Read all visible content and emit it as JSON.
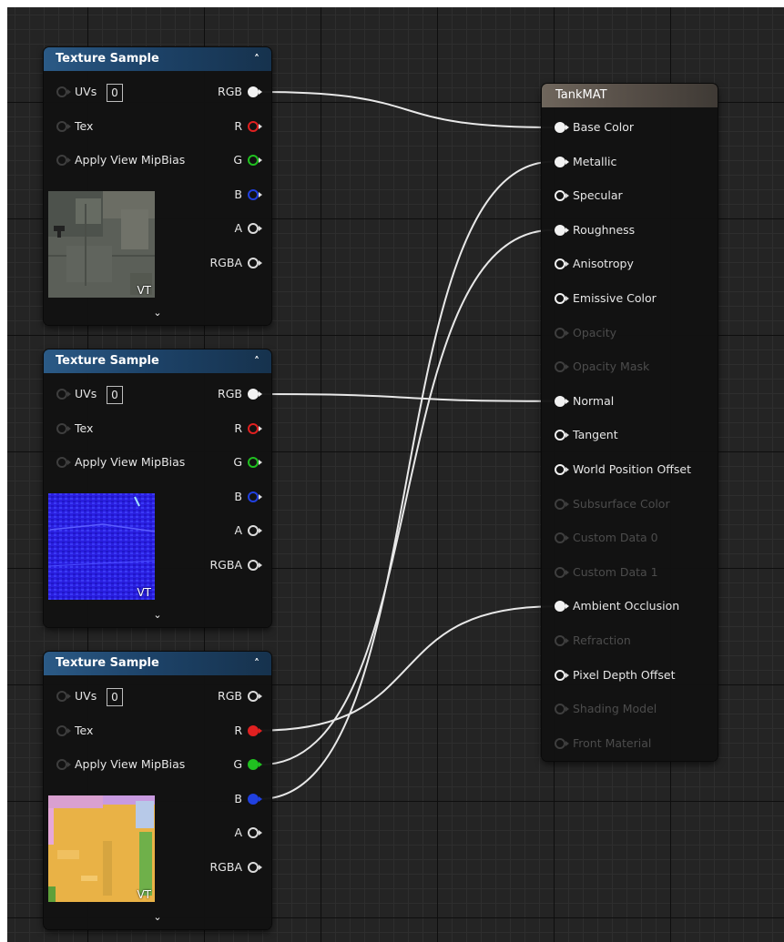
{
  "texture_nodes": [
    {
      "title": "Texture Sample",
      "uv_label": "UVs",
      "uv_value": "0",
      "tex_label": "Tex",
      "mip_label": "Apply View MipBias",
      "vt_label": "VT",
      "outputs": [
        {
          "label": "RGB",
          "color": "#f2f2f2",
          "connected": true
        },
        {
          "label": "R",
          "color": "#e02020",
          "connected": false
        },
        {
          "label": "G",
          "color": "#20c020",
          "connected": false
        },
        {
          "label": "B",
          "color": "#2040e0",
          "connected": false
        },
        {
          "label": "A",
          "color": "#dcdcdc",
          "connected": false
        },
        {
          "label": "RGBA",
          "color": "#dcdcdc",
          "connected": false
        }
      ]
    },
    {
      "title": "Texture Sample",
      "uv_label": "UVs",
      "uv_value": "0",
      "tex_label": "Tex",
      "mip_label": "Apply View MipBias",
      "vt_label": "VT",
      "outputs": [
        {
          "label": "RGB",
          "color": "#f2f2f2",
          "connected": true
        },
        {
          "label": "R",
          "color": "#e02020",
          "connected": false
        },
        {
          "label": "G",
          "color": "#20c020",
          "connected": false
        },
        {
          "label": "B",
          "color": "#2040e0",
          "connected": false
        },
        {
          "label": "A",
          "color": "#dcdcdc",
          "connected": false
        },
        {
          "label": "RGBA",
          "color": "#dcdcdc",
          "connected": false
        }
      ]
    },
    {
      "title": "Texture Sample",
      "uv_label": "UVs",
      "uv_value": "0",
      "tex_label": "Tex",
      "mip_label": "Apply View MipBias",
      "vt_label": "VT",
      "outputs": [
        {
          "label": "RGB",
          "color": "#dcdcdc",
          "connected": false
        },
        {
          "label": "R",
          "color": "#e02020",
          "connected": true
        },
        {
          "label": "G",
          "color": "#20c020",
          "connected": true
        },
        {
          "label": "B",
          "color": "#2040e0",
          "connected": true
        },
        {
          "label": "A",
          "color": "#dcdcdc",
          "connected": false
        },
        {
          "label": "RGBA",
          "color": "#dcdcdc",
          "connected": false
        }
      ]
    }
  ],
  "material_node": {
    "title": "TankMAT",
    "inputs": [
      {
        "label": "Base Color",
        "enabled": true,
        "connected": true
      },
      {
        "label": "Metallic",
        "enabled": true,
        "connected": true
      },
      {
        "label": "Specular",
        "enabled": true,
        "connected": false
      },
      {
        "label": "Roughness",
        "enabled": true,
        "connected": true
      },
      {
        "label": "Anisotropy",
        "enabled": true,
        "connected": false
      },
      {
        "label": "Emissive Color",
        "enabled": true,
        "connected": false
      },
      {
        "label": "Opacity",
        "enabled": false,
        "connected": false
      },
      {
        "label": "Opacity Mask",
        "enabled": false,
        "connected": false
      },
      {
        "label": "Normal",
        "enabled": true,
        "connected": true
      },
      {
        "label": "Tangent",
        "enabled": true,
        "connected": false
      },
      {
        "label": "World Position Offset",
        "enabled": true,
        "connected": false
      },
      {
        "label": "Subsurface Color",
        "enabled": false,
        "connected": false
      },
      {
        "label": "Custom Data 0",
        "enabled": false,
        "connected": false
      },
      {
        "label": "Custom Data 1",
        "enabled": false,
        "connected": false
      },
      {
        "label": "Ambient Occlusion",
        "enabled": true,
        "connected": true
      },
      {
        "label": "Refraction",
        "enabled": false,
        "connected": false
      },
      {
        "label": "Pixel Depth Offset",
        "enabled": true,
        "connected": false
      },
      {
        "label": "Shading Model",
        "enabled": false,
        "connected": false
      },
      {
        "label": "Front Material",
        "enabled": false,
        "connected": false
      }
    ]
  },
  "connections": [
    {
      "from_node": 0,
      "from_pin": "RGB",
      "to_pin": "Base Color"
    },
    {
      "from_node": 1,
      "from_pin": "RGB",
      "to_pin": "Normal"
    },
    {
      "from_node": 2,
      "from_pin": "R",
      "to_pin": "Ambient Occlusion"
    },
    {
      "from_node": 2,
      "from_pin": "G",
      "to_pin": "Roughness"
    },
    {
      "from_node": 2,
      "from_pin": "B",
      "to_pin": "Metallic"
    }
  ]
}
